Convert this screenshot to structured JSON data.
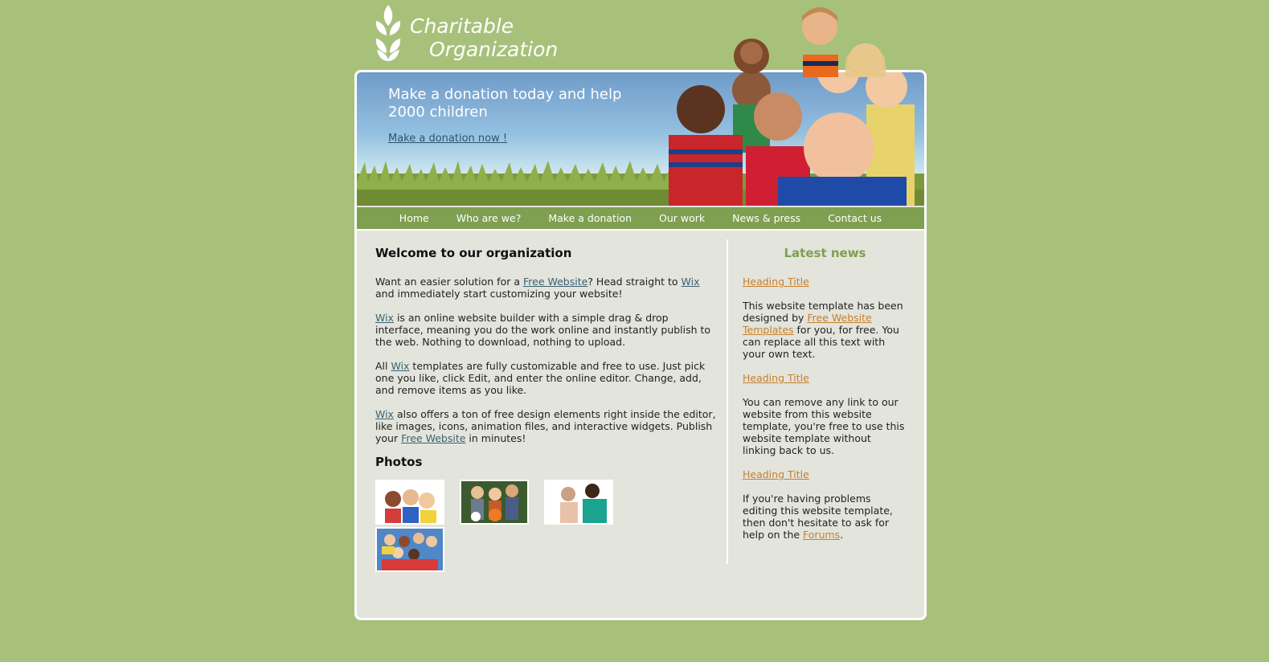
{
  "brand": {
    "line1": "Charitable",
    "line2": "Organization"
  },
  "banner": {
    "title": "Make a donation today and help 2000 children",
    "link": "Make a donation now !"
  },
  "nav": [
    "Home",
    "Who are we?",
    "Make a donation",
    "Our work",
    "News & press",
    "Contact us"
  ],
  "main": {
    "heading": "Welcome to our organization",
    "p1": {
      "a": "Want an easier solution for a ",
      "link1": "Free Website",
      "b": "? Head straight to ",
      "link2": "Wix",
      "c": " and immediately start customizing your website!"
    },
    "p2": {
      "link1": "Wix",
      "a": " is an online website builder with a simple drag & drop interface, meaning you do the work online and instantly publish to the web. Nothing to download, nothing to upload."
    },
    "p3": {
      "a": "All ",
      "link1": "Wix",
      "b": " templates are fully customizable and free to use. Just pick one you like, click Edit, and enter the online editor. Change, add, and remove items as you like."
    },
    "p4": {
      "link1": "Wix",
      "a": " also offers a ton of free design elements right inside the editor, like images, icons, animation files, and interactive widgets. Publish your ",
      "link2": "Free Website",
      "b": " in minutes!"
    },
    "photos_heading": "Photos"
  },
  "sidebar": {
    "title": "Latest news",
    "items": [
      {
        "heading": "Heading Title",
        "a": "This website template has been designed by ",
        "link": "Free Website Templates",
        "b": " for you, for free. You can replace all this text with your own text."
      },
      {
        "heading": "Heading Title",
        "a": "You can remove any link to our website from this website template, you're free to use this website template without linking back to us."
      },
      {
        "heading": "Heading Title",
        "a": "If you're having problems editing this website template, then don't hesitate to ask for help on the ",
        "link": "Forums",
        "b": "."
      }
    ]
  },
  "colors": {
    "background": "#a7c17b",
    "nav": "#7f9f51",
    "panel": "#e3e4dc",
    "link": "#3b6170",
    "accent_link": "#c7802d"
  }
}
